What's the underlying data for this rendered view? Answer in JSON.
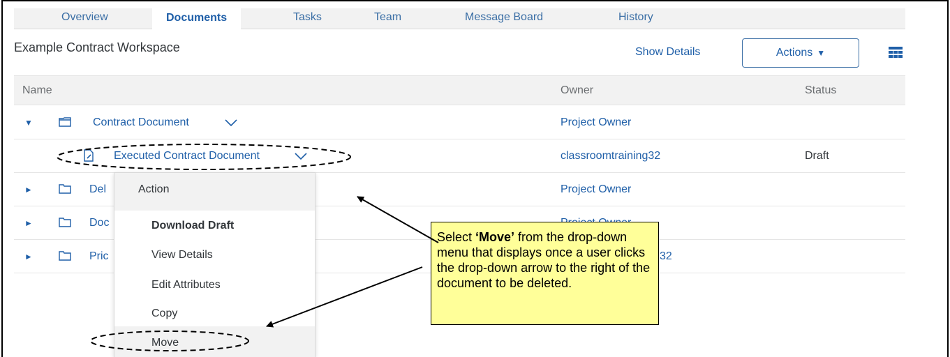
{
  "tabs": [
    {
      "label": "Overview"
    },
    {
      "label": "Documents",
      "active": true
    },
    {
      "label": "Tasks"
    },
    {
      "label": "Team"
    },
    {
      "label": "Message Board"
    },
    {
      "label": "History"
    }
  ],
  "workspace_title": "Example Contract Workspace",
  "toolbar": {
    "show_details": "Show Details",
    "actions": "Actions"
  },
  "table": {
    "columns": [
      "Name",
      "Owner",
      "Status"
    ],
    "rows": [
      {
        "name": "Contract Document",
        "owner": "Project Owner",
        "status": ""
      },
      {
        "name": "Executed Contract Document",
        "owner": "classroomtraining32",
        "status": "Draft"
      },
      {
        "name": "Del",
        "owner": "Project Owner",
        "status": ""
      },
      {
        "name": "Doc",
        "owner": "Project Owner",
        "status": ""
      },
      {
        "name": "Pric",
        "owner": "32",
        "status": ""
      }
    ]
  },
  "menu": {
    "header": "Action",
    "items": [
      "Download Draft",
      "View Details",
      "Edit Attributes",
      "Copy",
      "Move"
    ]
  },
  "callout": {
    "prefix": "Select ",
    "bold": "‘Move’",
    "suffix": " from the drop-down menu that displays once a user clicks the drop-down arrow to the right of the document to be deleted."
  },
  "colors": {
    "link": "#1f5fa8",
    "callout_bg": "#ffff99",
    "header_bg": "#f2f2f2"
  },
  "icons": [
    "caret-down-icon",
    "grid-view-icon",
    "folder-icon",
    "open-folder-icon",
    "document-edit-icon",
    "chevron-down-icon",
    "expand-triangle-icon",
    "collapse-triangle-icon"
  ]
}
